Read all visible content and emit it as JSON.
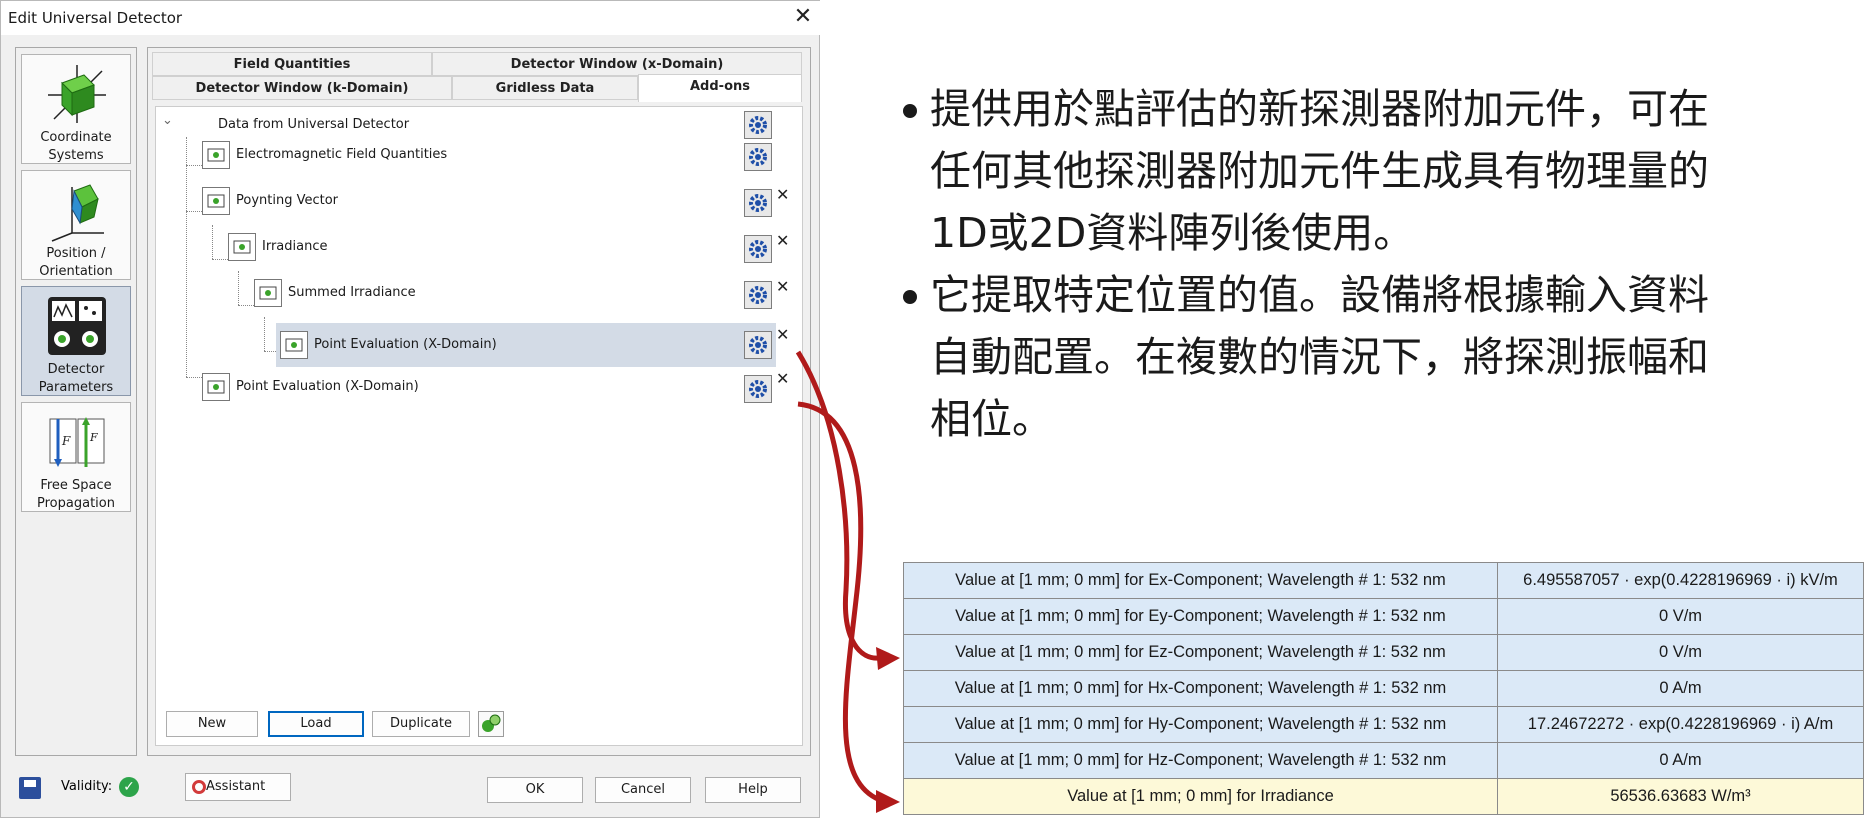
{
  "window": {
    "title": "Edit Universal Detector",
    "close_symbol": "✕"
  },
  "sidebar": {
    "items": [
      {
        "label_line1": "Coordinate",
        "label_line2": "Systems",
        "icon": "coordinate-cube-icon",
        "active": false
      },
      {
        "label_line1": "Position /",
        "label_line2": "Orientation",
        "icon": "position-orientation-icon",
        "active": false
      },
      {
        "label_line1": "Detector",
        "label_line2": "Parameters",
        "icon": "detector-parameters-icon",
        "active": true
      },
      {
        "label_line1": "Free Space",
        "label_line2": "Propagation",
        "icon": "fourier-transform-icon",
        "active": false
      }
    ]
  },
  "tabs": {
    "row1": [
      "Field Quantities",
      "Detector Window (x-Domain)"
    ],
    "row2": [
      "Detector Window (k-Domain)",
      "Gridless Data",
      "Add-ons"
    ],
    "active": "Add-ons"
  },
  "tree": {
    "root": "Data from Universal Detector",
    "nodes": [
      {
        "label": "Electromagnetic Field Quantities",
        "removable": false,
        "selected": false
      },
      {
        "label": "Poynting Vector",
        "removable": true,
        "selected": false
      },
      {
        "label": "Irradiance",
        "removable": true,
        "selected": false
      },
      {
        "label": "Summed Irradiance",
        "removable": true,
        "selected": false
      },
      {
        "label": "Point Evaluation (X-Domain)",
        "removable": true,
        "selected": true
      },
      {
        "label": "Point Evaluation (X-Domain)",
        "removable": true,
        "selected": false
      }
    ],
    "remove_symbol": "✕"
  },
  "panel_buttons": {
    "new": "New",
    "load": "Load",
    "duplicate": "Duplicate"
  },
  "footer": {
    "validity": "Validity:",
    "assistant": "Assistant",
    "ok": "OK",
    "cancel": "Cancel",
    "help": "Help"
  },
  "bullets": [
    {
      "line1": "提供用於點評估的新探測器附加元件，可在",
      "line2": "任何其他探測器附加元件生成具有物理量的",
      "line3": "1D或2D資料陣列後使用。"
    },
    {
      "line1": "它提取特定位置的值。設備將根據輸入資料",
      "line2": "自動配置。在複數的情況下，將探測振幅和",
      "line3": "相位。"
    }
  ],
  "results": [
    {
      "label": "Value at [1 mm; 0 mm]  for Ex-Component; Wavelength # 1: 532 nm",
      "value": "6.495587057 · exp(0.4228196969 · i) kV/m"
    },
    {
      "label": "Value at [1 mm; 0 mm]  for Ey-Component; Wavelength # 1: 532 nm",
      "value": "0 V/m"
    },
    {
      "label": "Value at [1 mm; 0 mm]  for Ez-Component; Wavelength # 1: 532 nm",
      "value": "0 V/m"
    },
    {
      "label": "Value at [1 mm; 0 mm]  for Hx-Component; Wavelength # 1: 532 nm",
      "value": "0 A/m"
    },
    {
      "label": "Value at [1 mm; 0 mm]  for Hy-Component; Wavelength # 1: 532 nm",
      "value": "17.24672272 · exp(0.4228196969 · i) A/m"
    },
    {
      "label": "Value at [1 mm; 0 mm]  for Hz-Component; Wavelength # 1: 532 nm",
      "value": "0 A/m"
    },
    {
      "label": "Value at [1 mm; 0 mm]  for Irradiance",
      "value": "56536.63683 W/m³"
    }
  ],
  "colors": {
    "arrow": "#b01a1a",
    "selection": "#d3dbe6",
    "table_blue": "#dbe9f7",
    "table_yellow": "#fdf9d8"
  }
}
